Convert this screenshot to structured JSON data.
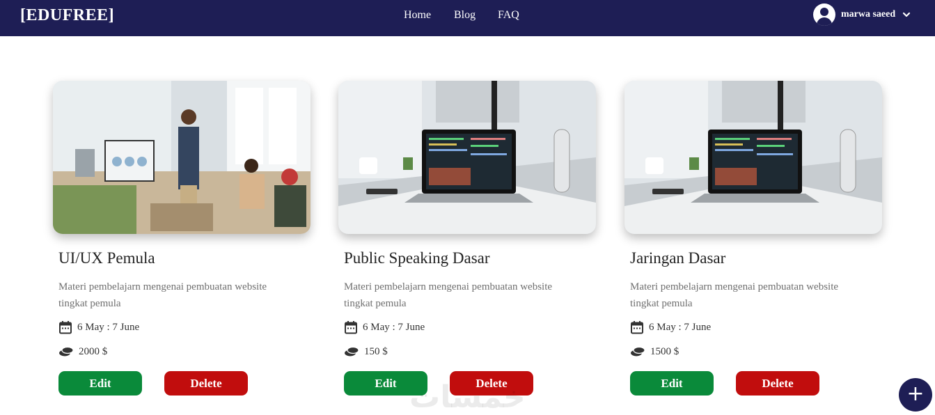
{
  "brand": "[EDUFREE]",
  "nav": {
    "home": "Home",
    "blog": "Blog",
    "faq": "FAQ"
  },
  "user": {
    "name": "marwa saeed"
  },
  "cards": [
    {
      "title": "UI/UX Pemula",
      "description": "Materi pembelajarn mengenai pembuatan website tingkat pemula",
      "date": "6 May : 7 June",
      "price": "2000 $",
      "edit_label": "Edit",
      "delete_label": "Delete"
    },
    {
      "title": "Public Speaking Dasar",
      "description": "Materi pembelajarn mengenai pembuatan website tingkat pemula",
      "date": "6 May : 7 June",
      "price": "150 $",
      "edit_label": "Edit",
      "delete_label": "Delete"
    },
    {
      "title": "Jaringan Dasar",
      "description": "Materi pembelajarn mengenai pembuatan website tingkat pemula",
      "date": "6 May : 7 June",
      "price": "1500 $",
      "edit_label": "Edit",
      "delete_label": "Delete"
    }
  ],
  "fab_label": "+",
  "watermark": "خمسات",
  "colors": {
    "navbar": "#1e1e55",
    "edit": "#0a8a3a",
    "delete": "#c10d0d"
  }
}
